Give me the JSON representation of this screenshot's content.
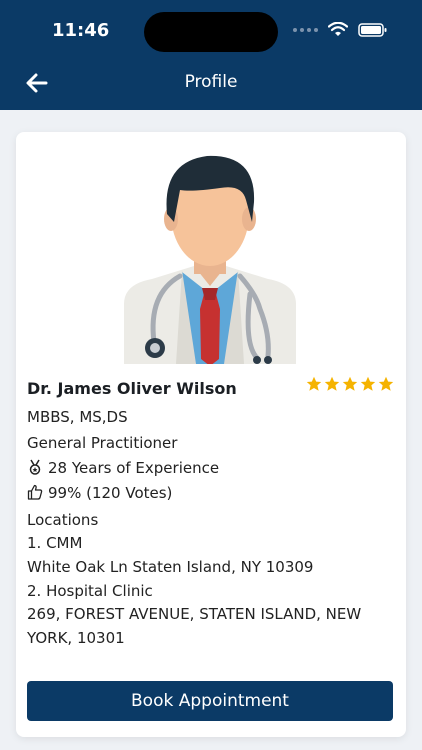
{
  "status_bar": {
    "time": "11:46"
  },
  "header": {
    "title": "Profile"
  },
  "doctor": {
    "name": "Dr. James Oliver Wilson",
    "rating": 5,
    "degrees": "MBBS, MS,DS",
    "specialty": "General Practitioner",
    "experience": "28 Years of Experience",
    "votes": "99% (120 Votes)",
    "locations_label": "Locations",
    "locations": [
      {
        "name": "1. CMM",
        "address": "White Oak Ln Staten Island, NY 10309"
      },
      {
        "name": "2. Hospital Clinic",
        "address_line1": "269, FOREST AVENUE, STATEN ISLAND, NEW",
        "address_line2": "YORK, 10301"
      }
    ]
  },
  "actions": {
    "book_label": "Book Appointment"
  },
  "colors": {
    "primary": "#0b3a66",
    "star": "#f5b300",
    "background": "#eef1f5"
  }
}
